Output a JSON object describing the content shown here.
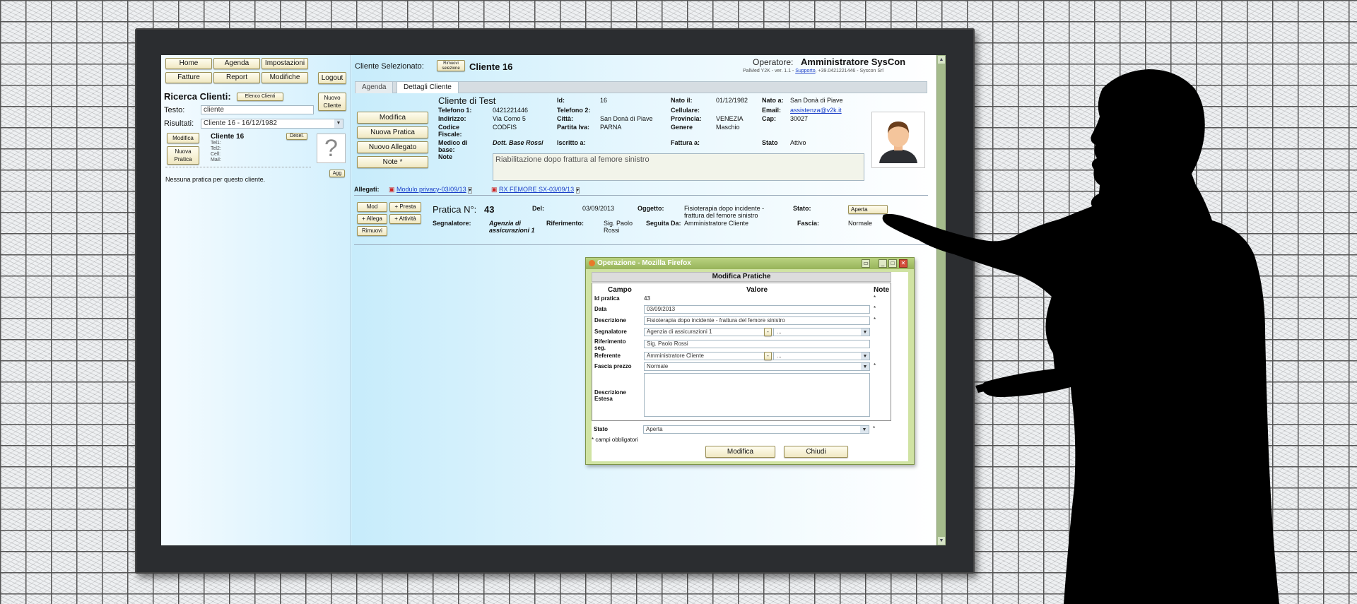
{
  "left": {
    "nav": [
      "Home",
      "Agenda",
      "Impostazioni",
      "Fatture",
      "Report",
      "Modifiche"
    ],
    "logout": "Logout",
    "search_title": "Ricerca Clienti:",
    "elenco_clienti": "Elenco Clienti",
    "nuovo_cliente": "Nuovo Cliente",
    "testo_label": "Testo:",
    "testo_value": "cliente",
    "risultati_label": "Risultati:",
    "risultati_value": "Cliente 16 - 16/12/1982",
    "card_modifica": "Modifica",
    "card_nuova_pratica": "Nuova Pratica",
    "card_name": "Cliente 16",
    "card_deselect": "Desel.",
    "card_lines": [
      "Tel1:",
      "Tel2:",
      "Cell:",
      "Mail:"
    ],
    "card_photo_placeholder": "?",
    "agg": "Agg",
    "no_pratica": "Nessuna pratica per questo cliente."
  },
  "header": {
    "selected_label": "Cliente Selezionato:",
    "remove_selection": "Rimuovi selezione",
    "selected_client": "Cliente 16",
    "operator_label": "Operatore:",
    "operator_name": "Amministratore SysCon",
    "version_prefix": "PalMed Y2K - ver. 1.1 - ",
    "version_link": "Supporto",
    "version_suffix": ", +39.0421221446 - Syscon Srl"
  },
  "tabs": [
    "Agenda",
    "Dettagli Cliente"
  ],
  "client": {
    "name": "Cliente di Test",
    "actions": [
      "Modifica",
      "Nuova Pratica",
      "Nuovo Allegato",
      "Note *"
    ],
    "id_label": "Id:",
    "id_value": "16",
    "nato_il_label": "Nato il:",
    "nato_il_value": "01/12/1982",
    "nato_a_label": "Nato a:",
    "nato_a_value": "San Donà di Piave",
    "tel1_label": "Telefono 1:",
    "tel1_value": "0421221446",
    "tel2_label": "Telefono 2:",
    "cell_label": "Cellulare:",
    "email_label": "Email:",
    "email_value": "assistenza@v2k.it",
    "indirizzo_label": "Indirizzo:",
    "indirizzo_value": "Via Como 5",
    "citta_label": "Città:",
    "citta_value": "San Donà di Piave",
    "provincia_label": "Provincia:",
    "provincia_value": "VENEZIA",
    "cap_label": "Cap:",
    "cap_value": "30027",
    "codice_label": "Codice Fiscale:",
    "codice_value": "CODFIS",
    "piva_label": "Partita Iva:",
    "piva_value": "PARNA",
    "genere_label": "Genere",
    "genere_value": "Maschio",
    "medico_label": "Medico di base:",
    "medico_value": "Dott. Base Rossi",
    "iscritto_label": "Iscritto a:",
    "fattura_label": "Fattura a:",
    "stato_label": "Stato",
    "stato_value": "Attivo",
    "note_label": "Note",
    "note_value": "Riabilitazione dopo frattura al femore sinistro"
  },
  "allegati": {
    "label": "Allegati:",
    "items": [
      "Modulo privacy-03/09/13",
      "RX FEMORE SX-03/09/13"
    ]
  },
  "pratica": {
    "buttons": [
      "Mod",
      "+ Presta",
      "+ Allega",
      "+ Attività",
      "Rimuovi"
    ],
    "number_label": "Pratica N°:",
    "number_value": "43",
    "del_label": "Del:",
    "del_value": "03/09/2013",
    "oggetto_label": "Oggetto:",
    "oggetto_value": "Fisioterapia dopo incidente - frattura del femore sinistro",
    "stato_label": "Stato:",
    "stato_value": "Aperta",
    "segnalatore_label": "Segnalatore:",
    "segnalatore_value": "Agenzia di assicurazioni 1",
    "riferimento_label": "Riferimento:",
    "riferimento_value": "Sig. Paolo Rossi",
    "seguita_label": "Seguita Da:",
    "seguita_value": "Amministratore Cliente",
    "fascia_label": "Fascia:",
    "fascia_value": "Normale"
  },
  "dialog": {
    "title": "Operazione - Mozilla Firefox",
    "header": "Modifica Pratiche",
    "col_campo": "Campo",
    "col_valore": "Valore",
    "col_note": "Note",
    "id_label": "Id pratica",
    "id_value": "43",
    "data_label": "Data",
    "data_value": "03/09/2013",
    "descr_label": "Descrizione",
    "descr_value": "Fisioterapia dopo incidente - frattura del femore sinistro",
    "segn_label": "Segnalatore",
    "segn_value": "Agenzia di assicurazioni 1",
    "rif_label": "Riferimento seg.",
    "rif_value": "Sig. Paolo Rossi",
    "ref_label": "Referente",
    "ref_value": "Amministratore Cliente",
    "fascia_label": "Fascia prezzo",
    "fascia_value": "Normale",
    "estesa_label": "Descrizione Estesa",
    "stato_label": "Stato",
    "stato_value": "Aperta",
    "ellipsis": "...",
    "minus": "-",
    "star": "*",
    "mandatory": "* campi obbligatori",
    "ok": "Modifica",
    "close": "Chiudi"
  }
}
